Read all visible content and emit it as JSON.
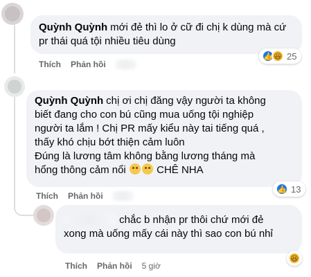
{
  "comments": [
    {
      "author": "Quỳnh Quỳnh",
      "text": "mới đẻ thì lo ở cữ đi chị k dùng mà cứ pr thái quá tội nhiều tiêu dùng",
      "actions": {
        "like": "Thích",
        "reply": "Phản hồi"
      },
      "reaction_count": "25"
    },
    {
      "author": "Quỳnh Quỳnh",
      "text_lines": [
        "chị ơi chị đăng vậy người ta không",
        "biết đang cho con bú cũng mua uống tội nghiệp",
        "người ta lắm ! Chị PR mấy kiểu này tai tiếng quá ,",
        "thấy khó chịu bớt thiện cảm luôn",
        "Đúng là lương tâm không bằng lương tháng mà",
        "hổng thông cảm nổi",
        "CHÊ NHA"
      ],
      "actions": {
        "like": "Thích",
        "reply": "Phản hồi"
      },
      "reaction_count": "13"
    },
    {
      "author": "",
      "text_lines": [
        "chắc b nhận pr thôi chứ mới đẻ",
        "xong mà uống mấy cái này thì sao con bú nhỉ"
      ],
      "actions": {
        "like": "Thích",
        "reply": "Phản hồi",
        "time": "5 giờ"
      }
    }
  ],
  "colors": {
    "bubble": "#f0f2f5",
    "like": "#1877f2",
    "haha": "#f7b928",
    "meta": "#65676b"
  },
  "icons": [
    "like-reaction-icon",
    "haha-reaction-icon",
    "sad-emoji-icon",
    "blurred-avatar-icon"
  ]
}
